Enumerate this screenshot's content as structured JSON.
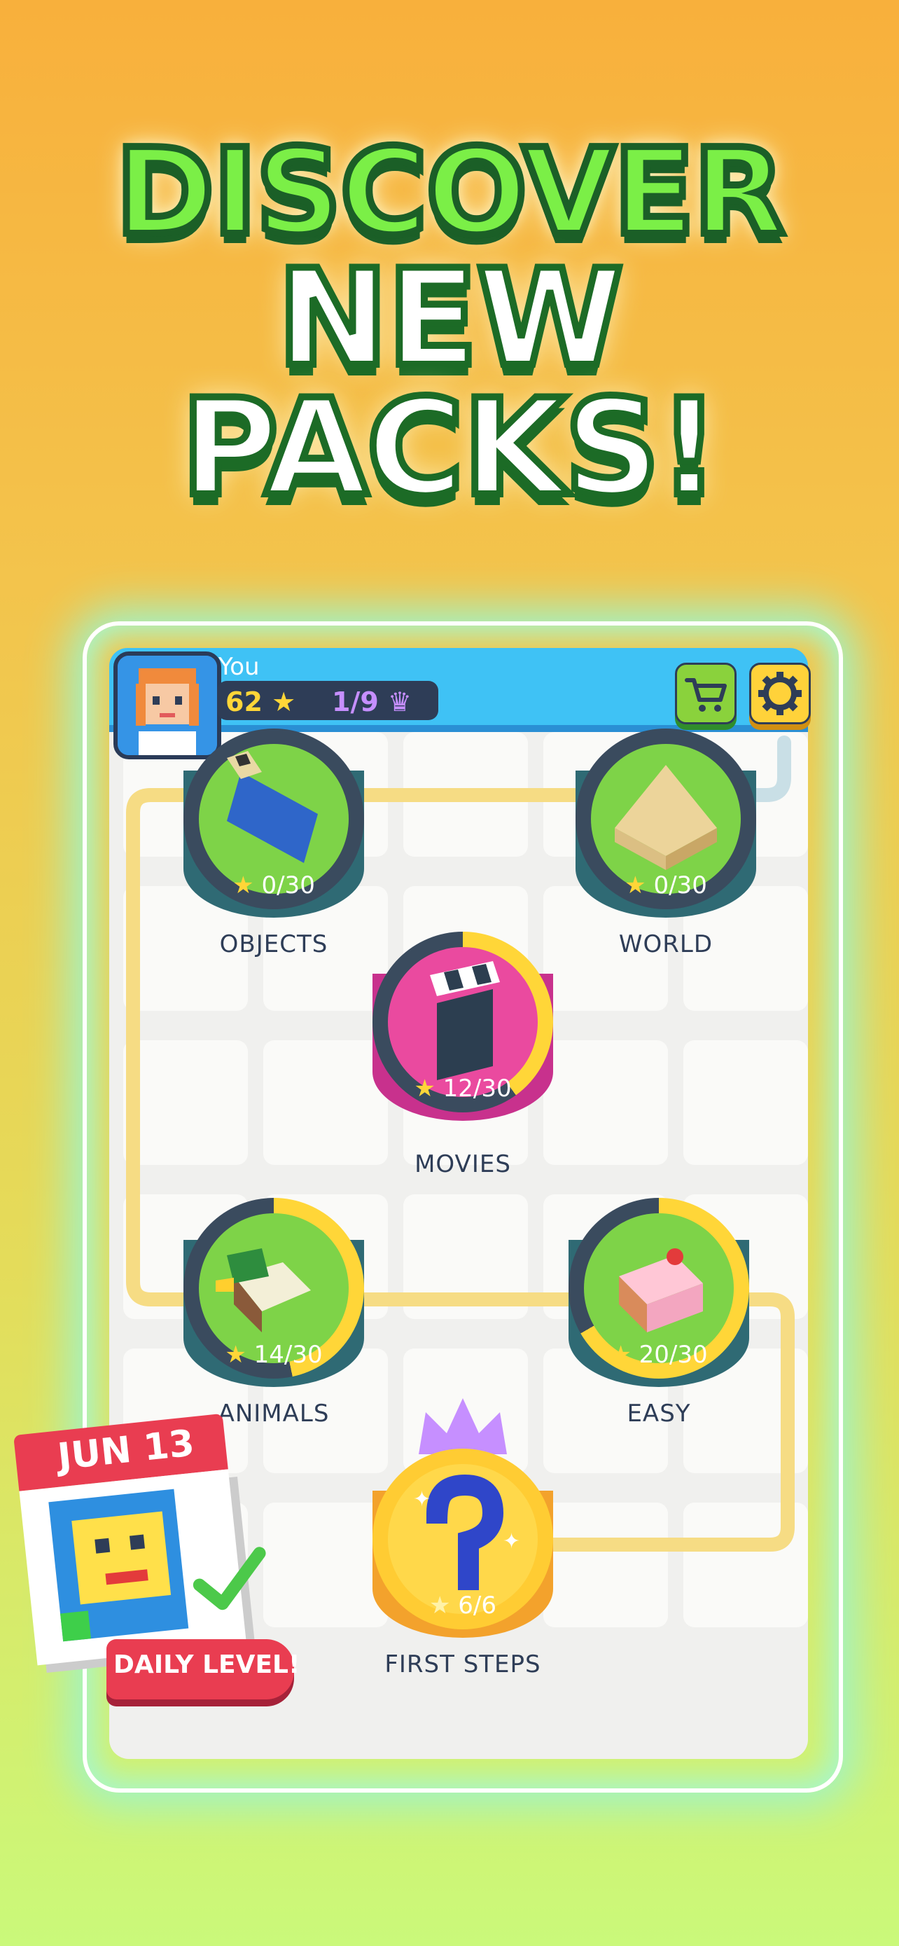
{
  "headline": {
    "line1": "DISCOVER",
    "line2": "NEW",
    "line3": "PACKS!"
  },
  "player": {
    "name": "You",
    "stars": "62",
    "crowns": "1/9"
  },
  "toolbar": {
    "cart_icon": "cart-icon",
    "settings_icon": "gear-icon"
  },
  "packs": [
    {
      "name": "OBJECTS",
      "progress": "0/30",
      "progress_fraction": 0.0
    },
    {
      "name": "WORLD",
      "progress": "0/30",
      "progress_fraction": 0.0
    },
    {
      "name": "MOVIES",
      "progress": "12/30",
      "progress_fraction": 0.4
    },
    {
      "name": "ANIMALS",
      "progress": "14/30",
      "progress_fraction": 0.47
    },
    {
      "name": "EASY",
      "progress": "20/30",
      "progress_fraction": 0.67
    },
    {
      "name": "FIRST STEPS",
      "progress": "6/6",
      "progress_fraction": 1.0
    }
  ],
  "daily": {
    "date": "JUN 13",
    "label": "DAILY LEVEL!"
  },
  "colors": {
    "accent_blue": "#3fc2f5",
    "accent_green": "#7ed348",
    "accent_pink": "#ea4a9f",
    "accent_yellow": "#ffd638",
    "daily_red": "#e93d51"
  }
}
